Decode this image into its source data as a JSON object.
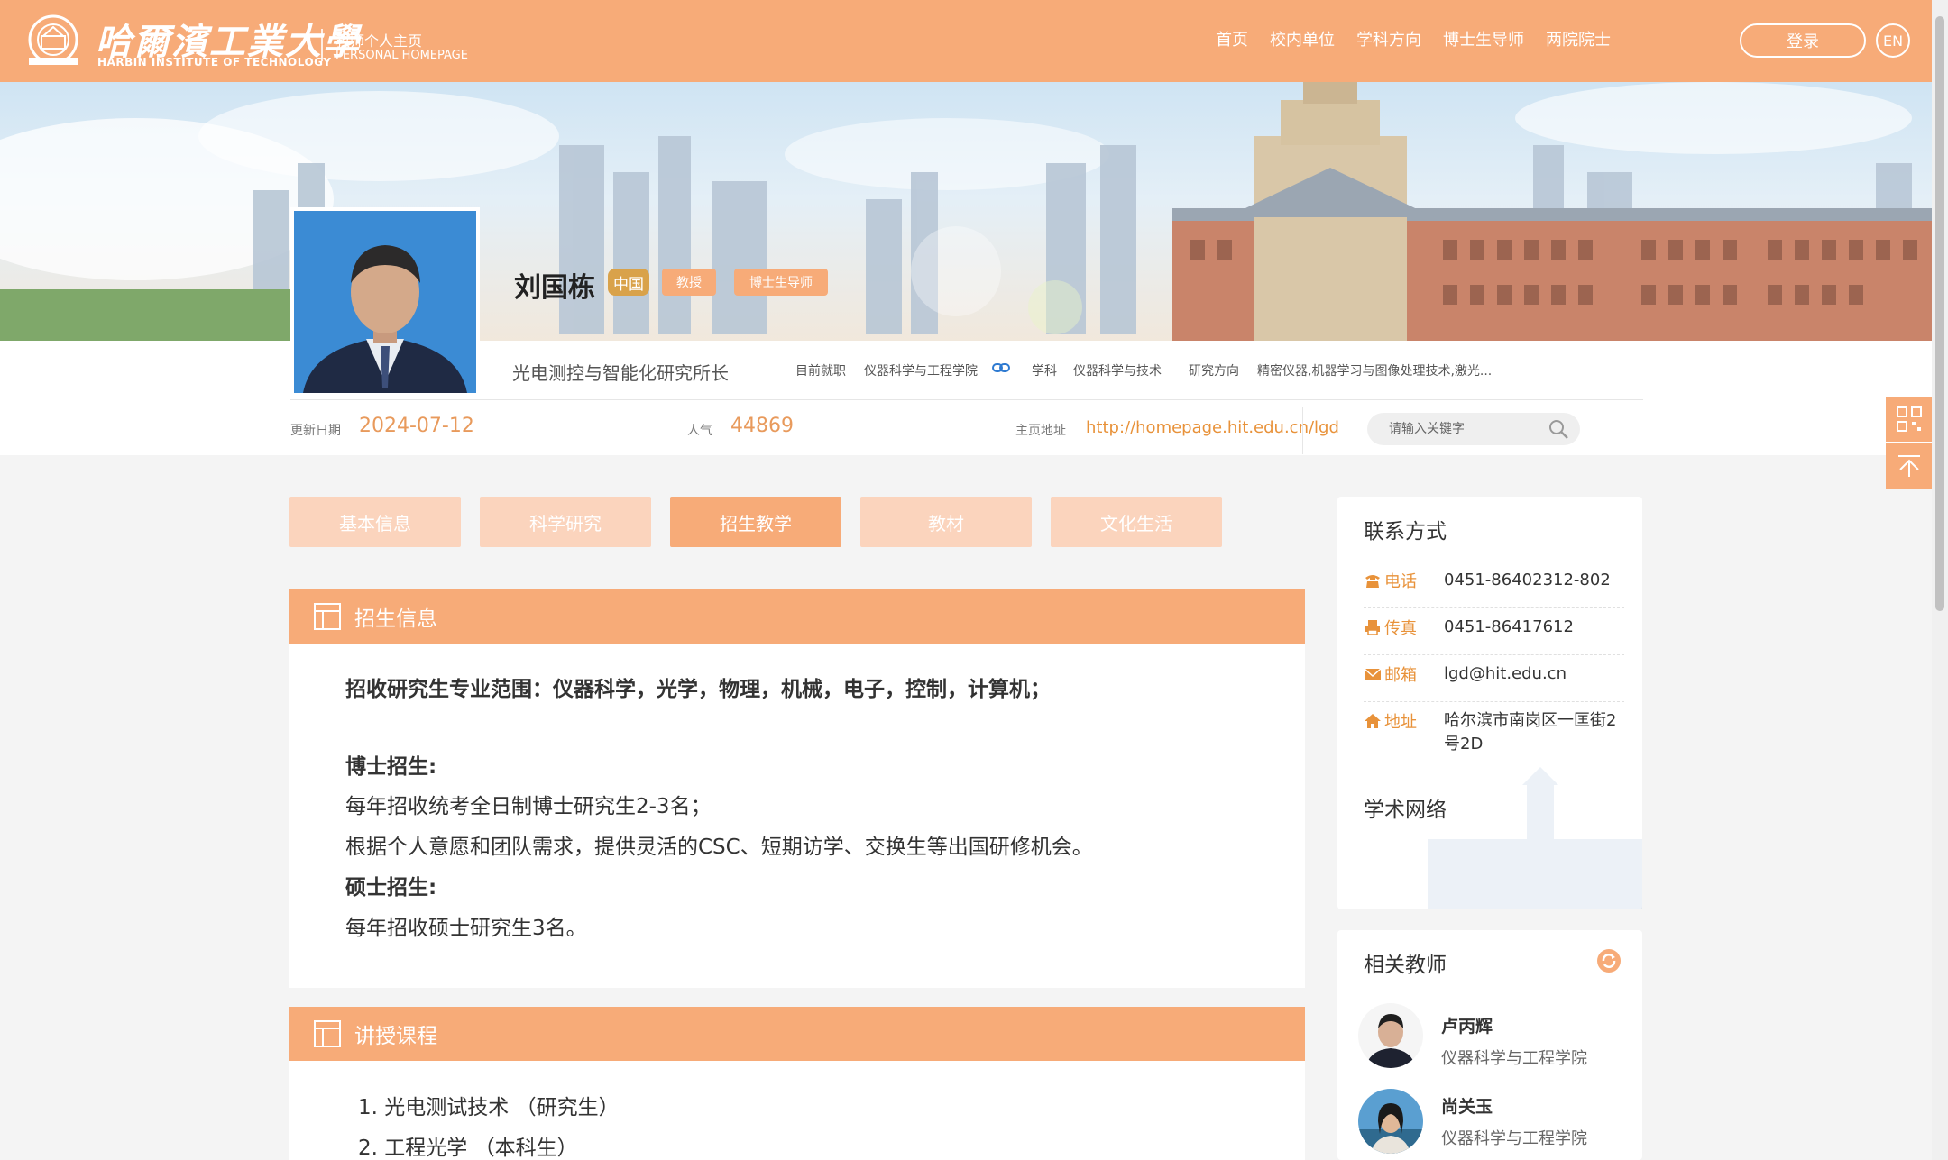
{
  "header": {
    "logo_cn": "哈爾濱工業大學",
    "logo_en": "HARBIN INSTITUTE OF TECHNOLOGY",
    "site_title_cn": "教师个人主页",
    "site_title_en": "PERSONAL HOMEPAGE",
    "nav": [
      "首页",
      "校内单位",
      "学科方向",
      "博士生导师",
      "两院院士"
    ],
    "login_label": "登录",
    "lang_label": "EN"
  },
  "profile": {
    "name": "刘国栋",
    "country_tag": "中国",
    "title_tag": "教授",
    "supervisor_tag": "博士生导师",
    "position": "光电测控与智能化研究所长",
    "employer_label": "目前就职",
    "employer_value": "仪器科学与工程学院",
    "discipline_label": "学科",
    "discipline_value": "仪器科学与技术",
    "research_label": "研究方向",
    "research_value": "精密仪器,机器学习与图像处理技术,激光..."
  },
  "stats": {
    "update_label": "更新日期",
    "update_value": "2024-07-12",
    "popularity_label": "人气",
    "popularity_value": "44869",
    "homepage_label": "主页地址",
    "homepage_value": "http://homepage.hit.edu.cn/lgd"
  },
  "search": {
    "placeholder": "请输入关键字"
  },
  "tabs": [
    "基本信息",
    "科学研究",
    "招生教学",
    "教材",
    "文化生活"
  ],
  "active_tab": "招生教学",
  "enrollment": {
    "title": "招生信息",
    "scope": "招收研究生专业范围：仪器科学，光学，物理，机械，电子，控制，计算机；",
    "phd_heading": "博士招生:",
    "phd_line1": "每年招收统考全日制博士研究生2-3名；",
    "phd_line2": "根据个人意愿和团队需求，提供灵活的CSC、短期访学、交换生等出国研修机会。",
    "master_heading": "硕士招生:",
    "master_line1": "每年招收硕士研究生3名。"
  },
  "courses": {
    "title": "讲授课程",
    "items": [
      "1. 光电测试技术 （研究生）",
      "2. 工程光学 （本科生）"
    ]
  },
  "contact": {
    "title": "联系方式",
    "rows": [
      {
        "label": "电话",
        "icon": "phone-icon",
        "value": "0451-86402312-802"
      },
      {
        "label": "传真",
        "icon": "fax-icon",
        "value": "0451-86417612"
      },
      {
        "label": "邮箱",
        "icon": "mail-icon",
        "value": "lgd@hit.edu.cn"
      },
      {
        "label": "地址",
        "icon": "home-icon",
        "value": "哈尔滨市南岗区一匡街2号2D"
      }
    ],
    "network_title": "学术网络"
  },
  "related": {
    "title": "相关教师",
    "teachers": [
      {
        "name": "卢丙辉",
        "dept": "仪器科学与工程学院"
      },
      {
        "name": "尚关玉",
        "dept": "仪器科学与工程学院"
      }
    ]
  },
  "colors": {
    "accent": "#f7ab78",
    "accent_light": "#fbd4bd",
    "link": "#e8923a"
  }
}
